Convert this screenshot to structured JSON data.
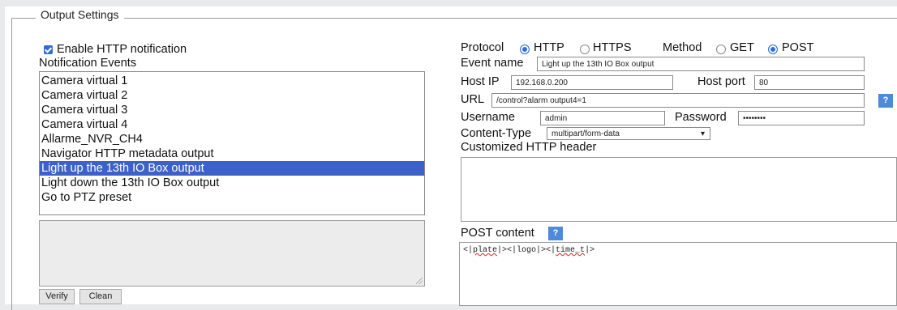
{
  "section_title": "Output Settings",
  "enable_http": {
    "label": "Enable HTTP notification",
    "checked": true
  },
  "notification_events": {
    "label": "Notification Events",
    "items": [
      "Camera virtual 1",
      "Camera virtual 2",
      "Camera virtual 3",
      "Camera virtual 4",
      "Allarme_NVR_CH4",
      "Navigator HTTP metadata output",
      "Light up the 13th IO Box output",
      "Light down the 13th IO Box output",
      "Go to PTZ preset"
    ],
    "selected_index": 6
  },
  "buttons": {
    "verify": "Verify",
    "clean": "Clean"
  },
  "protocol": {
    "label": "Protocol",
    "options": [
      "HTTP",
      "HTTPS"
    ],
    "selected": "HTTP"
  },
  "method": {
    "label": "Method",
    "options": [
      "GET",
      "POST"
    ],
    "selected": "POST"
  },
  "event_name": {
    "label": "Event name",
    "value": "Light up the 13th IO Box output"
  },
  "host_ip": {
    "label": "Host IP",
    "value": "192.168.0.200"
  },
  "host_port": {
    "label": "Host port",
    "value": "80"
  },
  "url": {
    "label": "URL",
    "value": "/control?alarm output4=1"
  },
  "username": {
    "label": "Username",
    "value": "admin"
  },
  "password": {
    "label": "Password",
    "value": "••••••••"
  },
  "content_type": {
    "label": "Content-Type",
    "value": "multipart/form-data"
  },
  "custom_header": {
    "label": "Customized HTTP header",
    "value": ""
  },
  "post_content": {
    "label": "POST content",
    "tokens": [
      "<|",
      "plate",
      "|><|logo|><|",
      "time_t",
      "|>"
    ]
  },
  "help_glyph": "?",
  "colors": {
    "selection": "#3c61c8",
    "accent": "#2d6fd6",
    "help_button": "#4d8bd8"
  }
}
